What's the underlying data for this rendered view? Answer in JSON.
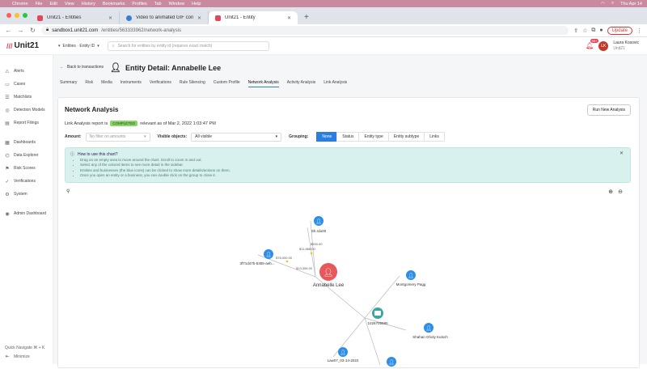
{
  "menubar": {
    "items": [
      "Chrome",
      "File",
      "Edit",
      "View",
      "History",
      "Bookmarks",
      "Profiles",
      "Tab",
      "Window",
      "Help"
    ],
    "clock": "Thu Apr 14"
  },
  "browser": {
    "tabs": [
      {
        "title": "Unit21 - Entities"
      },
      {
        "title": "Video to animated GIF conver..."
      },
      {
        "title": "Unit21 - Entity"
      }
    ],
    "url_host": "sandbox1.unit21.com",
    "url_path": "/entities/563333962/network-analysis",
    "update_label": "Update"
  },
  "app": {
    "logo": "Unit21",
    "entity_select": "Entities · Entity ID",
    "search_placeholder": "Search for entities by entity id (requires exact match)",
    "notification_count": "99+",
    "user_initials": "LK",
    "user_name": "Laura Kosovic",
    "user_org": "Unit21"
  },
  "sidebar": {
    "items": [
      {
        "icon": "alert-icon",
        "label": "Alerts"
      },
      {
        "icon": "cases-icon",
        "label": "Cases"
      },
      {
        "icon": "matchlist-icon",
        "label": "Matchlists"
      },
      {
        "icon": "detection-icon",
        "label": "Detection Models"
      },
      {
        "icon": "report-icon",
        "label": "Report Filings"
      }
    ],
    "items2": [
      {
        "icon": "dashboard-icon",
        "label": "Dashboards"
      },
      {
        "icon": "explorer-icon",
        "label": "Data Explorer"
      },
      {
        "icon": "risk-icon",
        "label": "Risk Scores"
      },
      {
        "icon": "verification-icon",
        "label": "Verifications"
      },
      {
        "icon": "system-icon",
        "label": "System"
      }
    ],
    "items3": [
      {
        "icon": "admin-icon",
        "label": "Admin Dashboard"
      }
    ],
    "quick_navigate": "Quick Navigate  ⌘ + K",
    "minimize": "Minimize"
  },
  "page": {
    "back_label": "Back to transactions",
    "entity_title": "Entity Detail: Annabelle Lee",
    "tabs": [
      "Summary",
      "Risk",
      "Media",
      "Instruments",
      "Verifications",
      "Rule Silencing",
      "Custom Profile",
      "Network Analysis",
      "Activity Analysis",
      "Link Analysis"
    ]
  },
  "network": {
    "title": "Network Analysis",
    "run_button": "Run New Analysis",
    "report_prefix": "Link Analysis report is",
    "status": "COMPLETED",
    "report_suffix": "relevant as of Mar 2, 2022 1:03:47 PM",
    "amount_label": "Amount:",
    "amount_placeholder": "No filter on amounts",
    "visible_label": "Visible objects:",
    "visible_value": "All visible",
    "grouping_label": "Grouping:",
    "grouping_options": [
      "None",
      "Status",
      "Entity type",
      "Entity subtype",
      "Links"
    ],
    "help_title": "How to use this chart?",
    "help_items": [
      "Drag on an empty area to move around the chart. Scroll to zoom in and out.",
      "Select any of the colored items to see more detail in the sidebar.",
      "Entities and businesses (the blue icons) can be clicked to show more details/actions on them.",
      "Once you open an entity or a business, you can double click on the group to close it."
    ],
    "nodes": {
      "center": "Annabelle Lee",
      "top": "Sh.rdu00",
      "left": "3f71d47b-5355-aeb...",
      "right": "Montgomery Pagg",
      "hub": "1026705580",
      "bottom_right": "Shahan Gholy Kutsch",
      "bottom_left": "Law07_03-14-2022"
    },
    "edges": {
      "e1": "$500.00",
      "e2": "$11,868.00",
      "e3": "$78,000.00",
      "e4": "$13,306.00"
    }
  },
  "colors": {
    "accent": "#2a7de1",
    "primary_node": "#e8585b",
    "entity_node": "#2d8ee6",
    "hub_node": "#3aa6a0"
  }
}
